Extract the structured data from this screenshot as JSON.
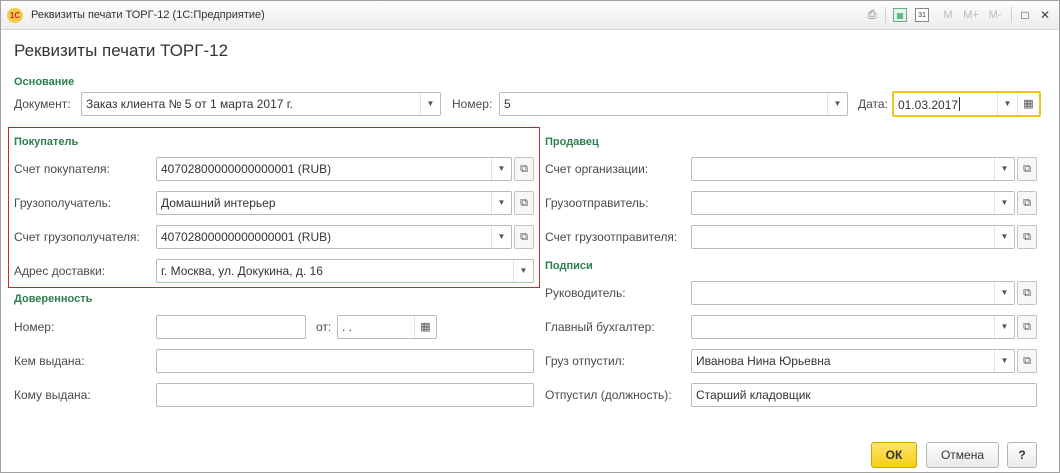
{
  "window": {
    "title": "Реквизиты печати ТОРГ-12  (1С:Предприятие)",
    "app_logo": "1С",
    "toolbar_icons": [
      "print-icon",
      "calculator-icon",
      "calendar-icon"
    ],
    "calendar_day": "31",
    "memory": [
      "M",
      "M+",
      "M-"
    ],
    "controls": [
      "menu-icon",
      "maximize-icon",
      "close-icon"
    ]
  },
  "form": {
    "title": "Реквизиты печати ТОРГ-12"
  },
  "basis": {
    "group_title": "Основание",
    "document_label": "Документ:",
    "document_value": "Заказ клиента № 5 от 1 марта 2017 г.",
    "number_label": "Номер:",
    "number_value": "5",
    "date_label": "Дата:",
    "date_value": "01.03.2017"
  },
  "buyer": {
    "group_title": "Покупатель",
    "account_label": "Счет покупателя:",
    "account_value": "40702800000000000001 (RUB)",
    "consignee_label": "Грузополучатель:",
    "consignee_value": "Домашний интерьер",
    "consignee_account_label": "Счет грузополучателя:",
    "consignee_account_value": "40702800000000000001 (RUB)",
    "delivery_label": "Адрес доставки:",
    "delivery_value": "г. Москва, ул. Докукина, д. 16"
  },
  "proxy": {
    "group_title": "Доверенность",
    "number_label": "Номер:",
    "number_value": "",
    "from_label": "от:",
    "from_value": " .  .",
    "issued_by_label": "Кем выдана:",
    "issued_by_value": "",
    "issued_to_label": "Кому выдана:",
    "issued_to_value": ""
  },
  "seller": {
    "group_title": "Продавец",
    "org_account_label": "Счет организации:",
    "org_account_value": "",
    "shipper_label": "Грузоотправитель:",
    "shipper_value": "",
    "shipper_account_label": "Счет грузоотправителя:",
    "shipper_account_value": ""
  },
  "signatures": {
    "group_title": "Подписи",
    "head_label": "Руководитель:",
    "head_value": "",
    "accountant_label": "Главный бухгалтер:",
    "accountant_value": "",
    "released_label": "Груз отпустил:",
    "released_value": "Иванова Нина Юрьевна",
    "position_label": "Отпустил (должность):",
    "position_value": "Старший кладовщик"
  },
  "buttons": {
    "ok": "ОК",
    "cancel": "Отмена",
    "help": "?"
  },
  "colors": {
    "group_title": "#2e7d4f",
    "highlight": "#c62828",
    "active_field": "#f0c419",
    "ok_button": "#f5cf16"
  }
}
